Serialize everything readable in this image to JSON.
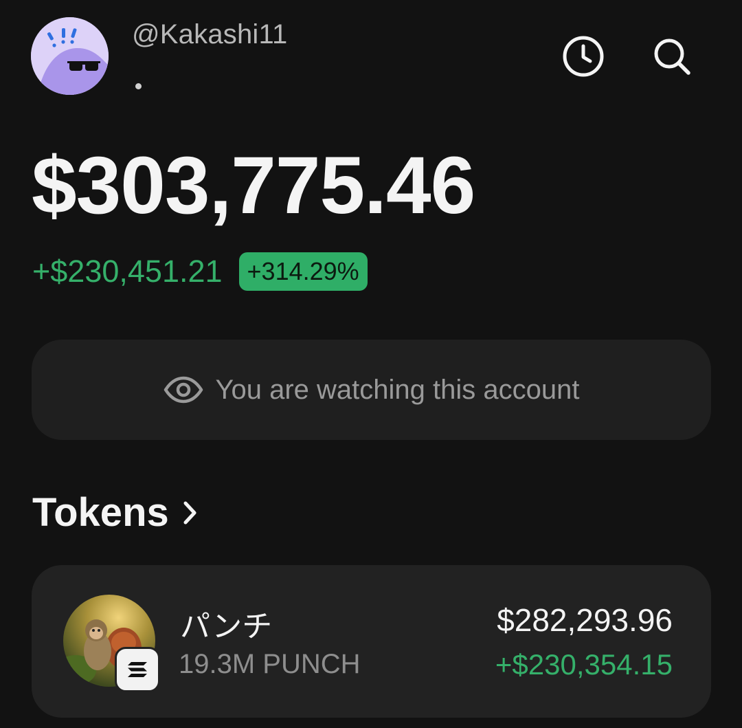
{
  "profile": {
    "username": "@Kakashi11",
    "avatar_icon": "sunglasses-ghost-avatar"
  },
  "header": {
    "history_icon": "clock-icon",
    "search_icon": "search-icon"
  },
  "portfolio": {
    "balance": "$303,775.46",
    "change_amount": "+$230,451.21",
    "change_percent": "+314.29%"
  },
  "watch_banner": {
    "icon": "eye-icon",
    "text": "You are watching this account"
  },
  "tokens": {
    "title": "Tokens",
    "chevron_icon": "chevron-right-icon",
    "items": [
      {
        "name": "パンチ",
        "amount": "19.3M PUNCH",
        "value": "$282,293.96",
        "pnl": "+$230,354.15",
        "chain_icon": "solana-icon"
      }
    ]
  },
  "colors": {
    "background": "#121212",
    "card": "#222222",
    "positive": "#35b06a",
    "badge_positive": "#2fae67"
  }
}
